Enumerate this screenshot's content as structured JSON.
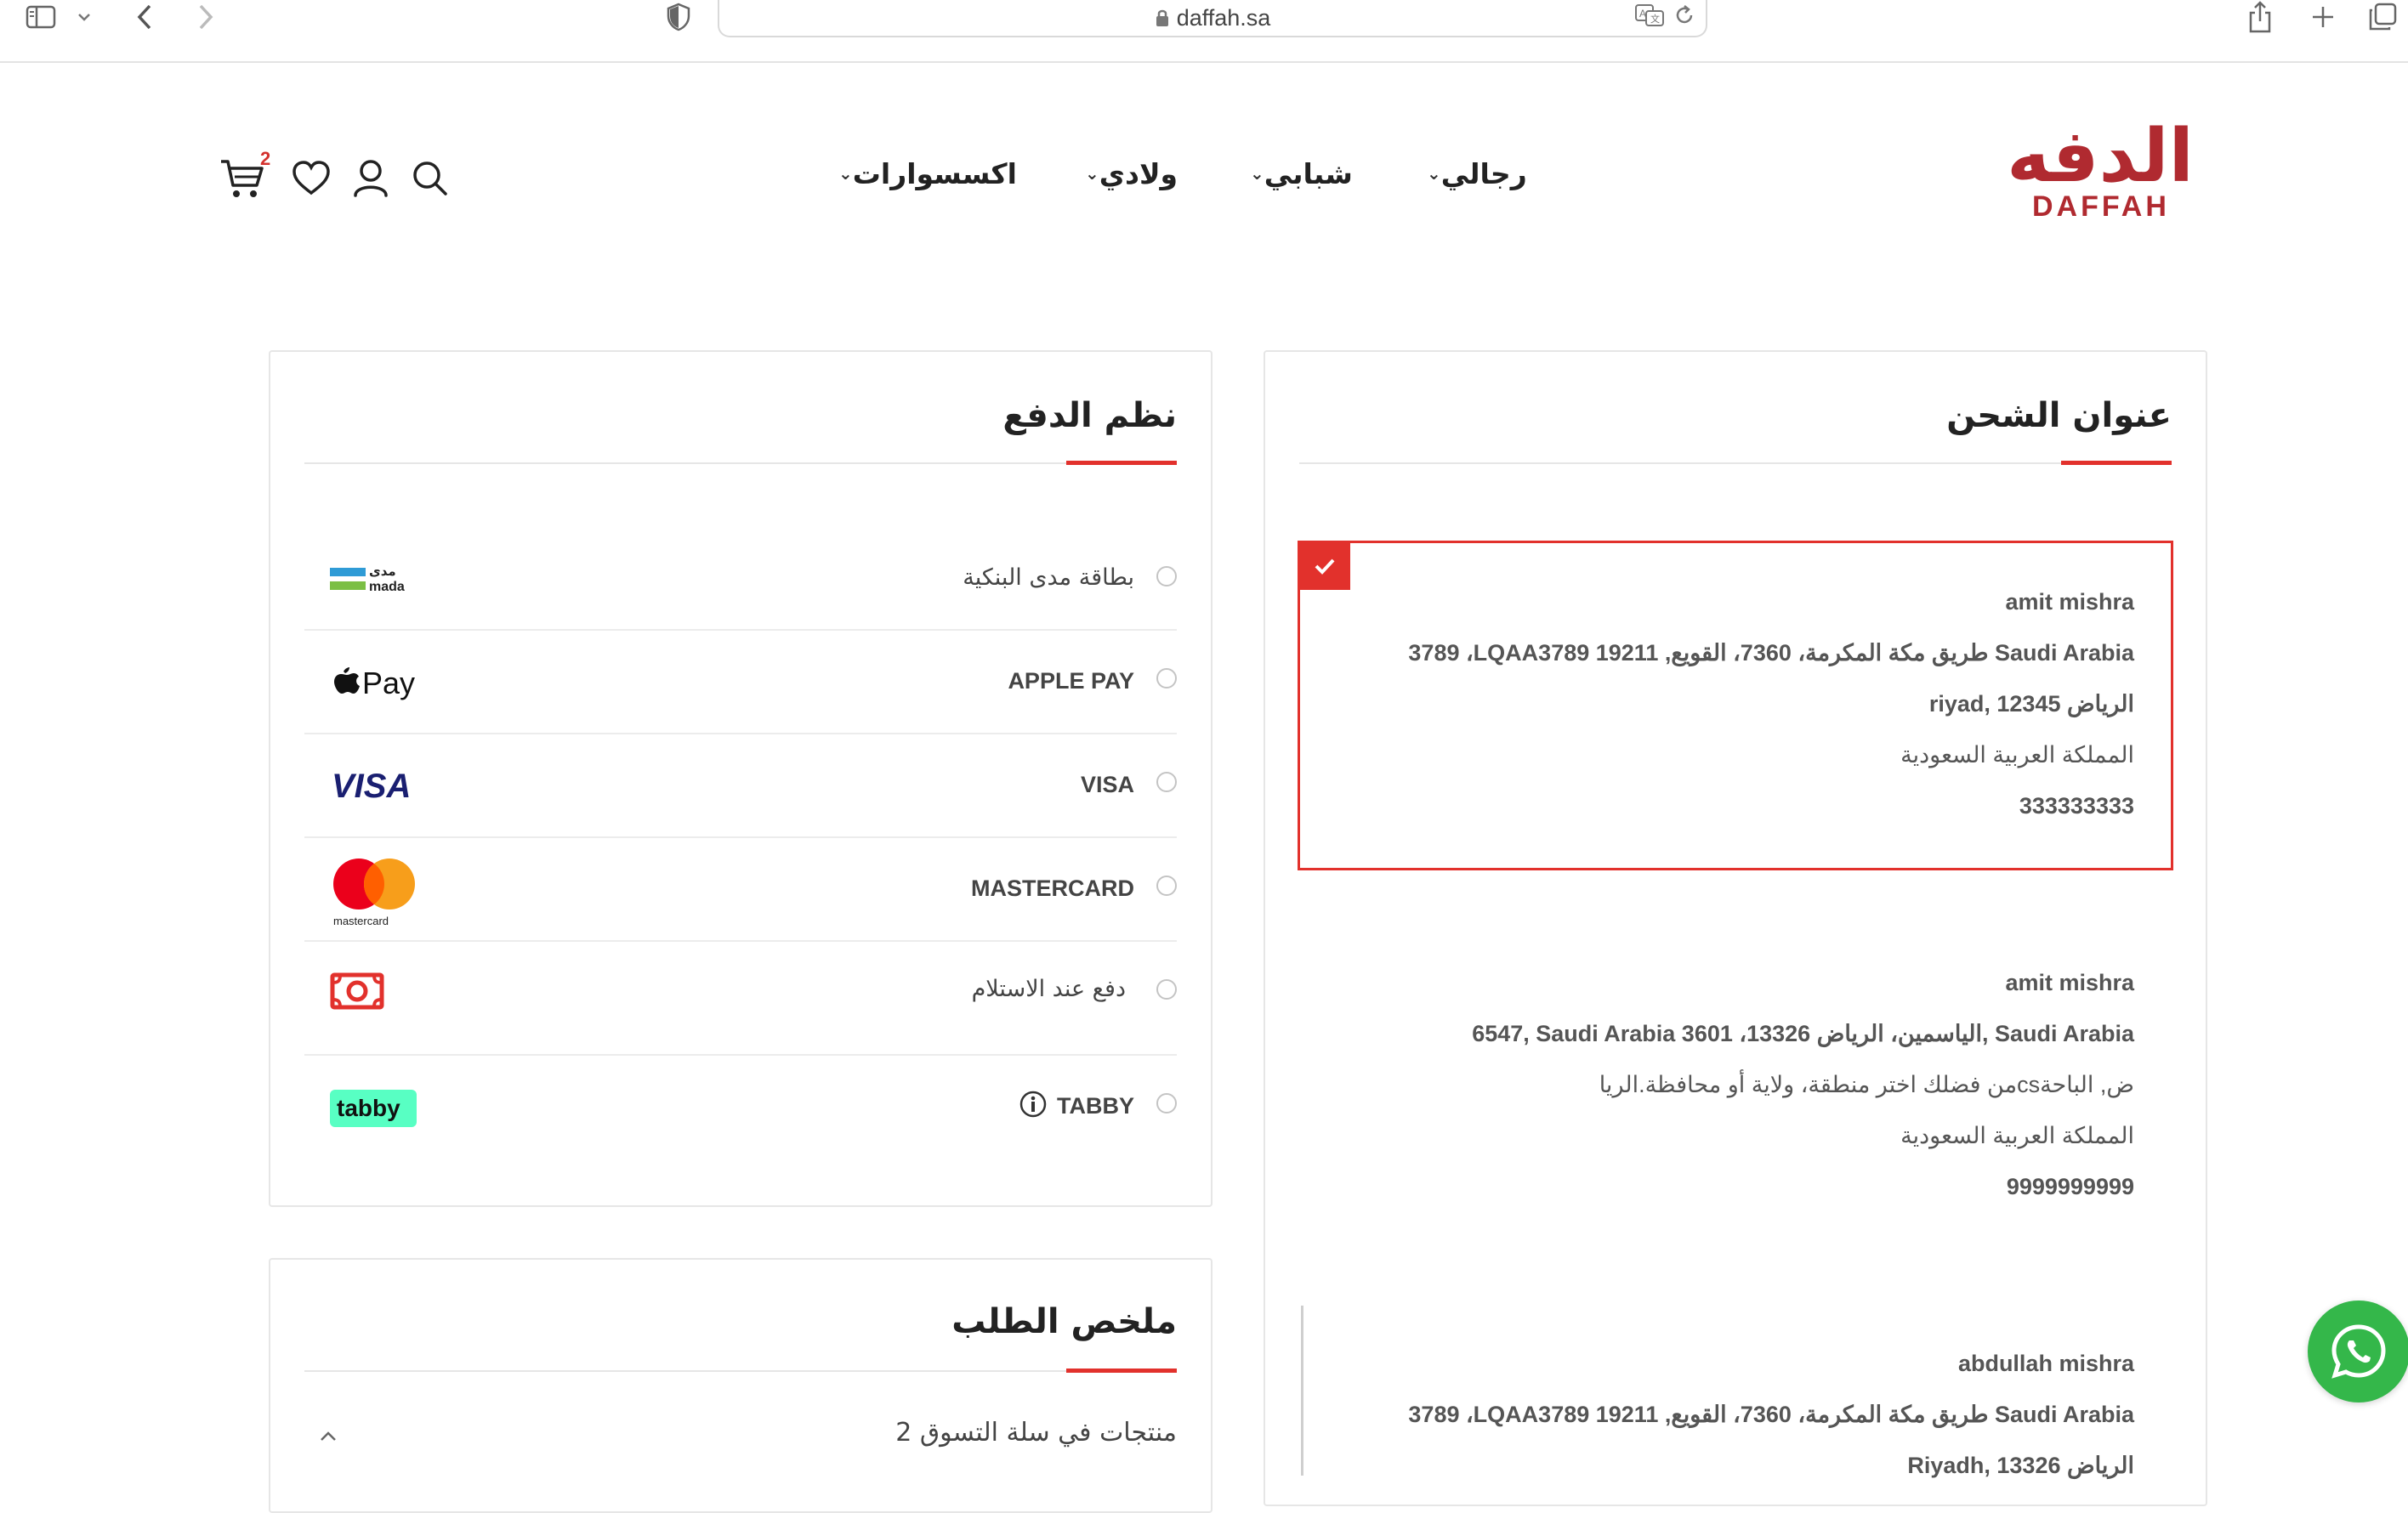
{
  "browser": {
    "url": "daffah.sa"
  },
  "header": {
    "logo_ar": "الدفه",
    "logo_en": "DAFFAH",
    "nav": [
      {
        "label": "رجالي"
      },
      {
        "label": "شبابي"
      },
      {
        "label": "ولادي"
      },
      {
        "label": "اكسسوارات"
      }
    ],
    "cart_count": "2"
  },
  "payment": {
    "title": "نظم الدفع",
    "methods": [
      {
        "label": "بطاقة مدى البنكية",
        "logo": "mada-logo"
      },
      {
        "label": "APPLE PAY",
        "logo": "apple-pay-logo",
        "logo_text": "Pay"
      },
      {
        "label": "VISA",
        "logo": "visa-logo",
        "logo_text": "VISA"
      },
      {
        "label": "MASTERCARD",
        "logo": "mastercard-logo",
        "logo_text": "mastercard"
      },
      {
        "label": "دفع عند الاستلام",
        "logo": "cash-icon"
      },
      {
        "label": "TABBY",
        "logo": "tabby-logo",
        "logo_text": "tabby"
      }
    ],
    "mada_ar": "مدى",
    "mada_en": "mada"
  },
  "shipping": {
    "title": "عنوان الشحن",
    "addresses": [
      {
        "name": "amit mishra",
        "line1": "3789 ،LQAA3789 طريق مكة المكرمة، 7360، القويع, 19211 Saudi Arabia",
        "line2": "riyad, الرياض 12345",
        "line3": "المملكة العربية السعودية",
        "phone": "333333333",
        "selected": true
      },
      {
        "name": "amit mishra",
        "line1": "6547, Saudi Arabia 3601 ،الياسمين، الرياض 13326, Saudi Arabia",
        "line2": "من فضلك اختر منطقة، ولاية أو محافظة.الرياcsض, الباحة",
        "line3": "المملكة العربية السعودية",
        "phone": "9999999999",
        "selected": false
      },
      {
        "name": "abdullah mishra",
        "line1": "3789 ،LQAA3789 طريق مكة المكرمة، 7360، القويع, 19211 Saudi Arabia",
        "line2": "Riyadh, الرياض 13326",
        "selected": false
      }
    ]
  },
  "summary": {
    "title": "ملخص الطلب",
    "items_in_cart": "2 منتجات في سلة التسوق"
  },
  "colors": {
    "accent": "#e2312c",
    "brand": "#b02a30",
    "whatsapp": "#34b74a"
  }
}
